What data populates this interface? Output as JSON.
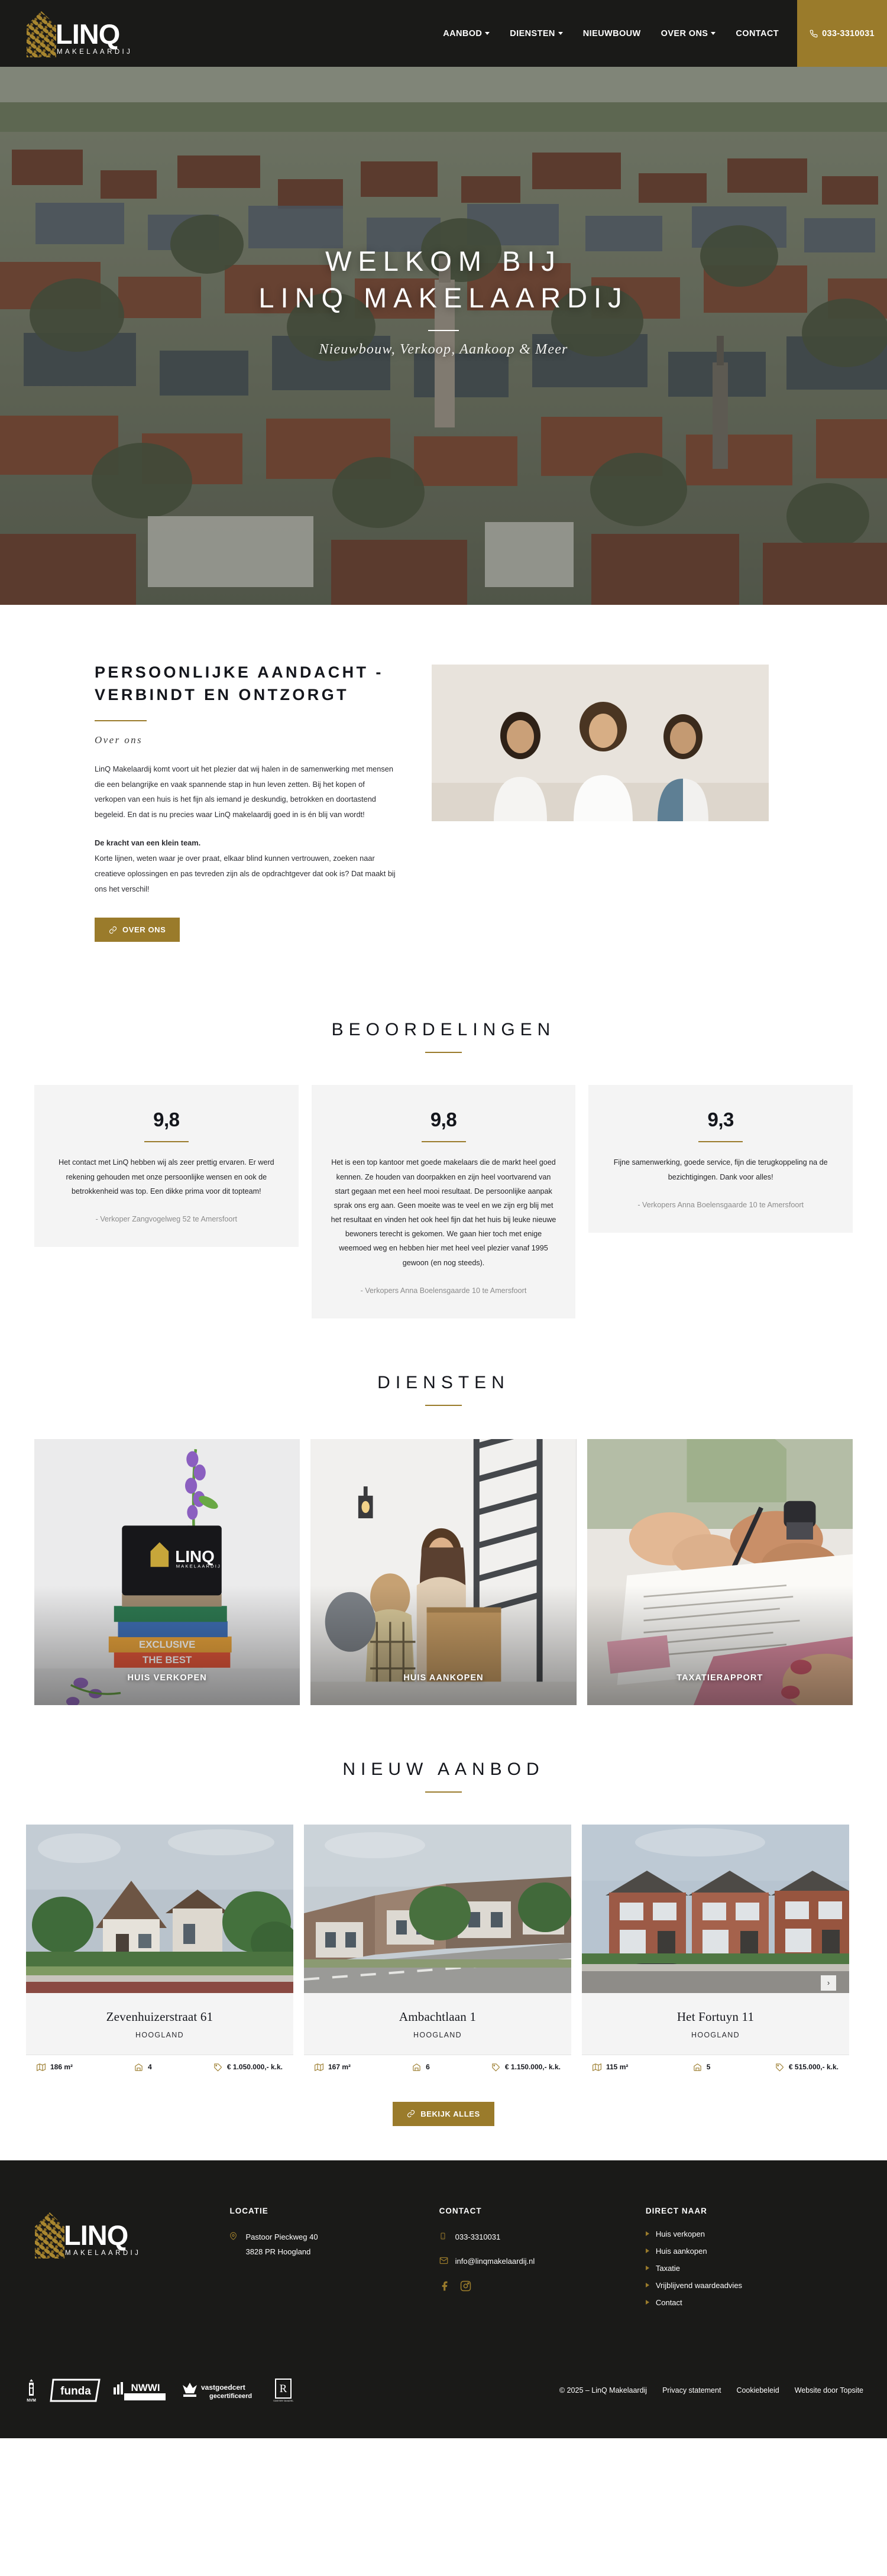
{
  "header": {
    "logo_name": "LINQ",
    "logo_sub": "MAKELAARDIJ",
    "nav": [
      {
        "label": "AANBOD",
        "has_caret": true
      },
      {
        "label": "DIENSTEN",
        "has_caret": true
      },
      {
        "label": "NIEUWBOUW",
        "has_caret": false
      },
      {
        "label": "OVER ONS",
        "has_caret": true
      },
      {
        "label": "CONTACT",
        "has_caret": false
      }
    ],
    "phone": "033-3310031"
  },
  "hero": {
    "title_line1": "WELKOM BIJ",
    "title_line2": "LINQ MAKELAARDIJ",
    "subtitle": "Nieuwbouw, Verkoop, Aankoop & Meer"
  },
  "about": {
    "heading": "PERSOONLIJKE AANDACHT - VERBINDT EN ONTZORGT",
    "eyebrow": "Over ons",
    "paragraph1": "LinQ Makelaardij komt voort uit het plezier dat wij halen in de samenwerking met mensen die een belangrijke en vaak spannende stap in hun leven zetten. Bij het kopen of verkopen van een huis is het fijn als iemand je deskundig, betrokken en doortastend begeleid. En dat is nu precies waar LinQ makelaardij goed in is én blij van wordt!",
    "bold_line": "De kracht van een klein team.",
    "paragraph2": "Korte lijnen, weten waar je over praat, elkaar blind kunnen vertrouwen, zoeken naar creatieve oplossingen en pas tevreden zijn als de opdrachtgever dat ook is? Dat maakt bij ons het verschil!",
    "button": "OVER ONS"
  },
  "reviews": {
    "title": "BEOORDELINGEN",
    "cards": [
      {
        "score": "9,8",
        "text": "Het contact met LinQ hebben wij als zeer prettig ervaren. Er werd rekening gehouden met onze persoonlijke wensen en ook de betrokkenheid was top. Een dikke prima voor dit topteam!",
        "author": "- Verkoper Zangvogelweg 52 te Amersfoort"
      },
      {
        "score": "9,8",
        "text": "Het is een top kantoor met goede makelaars die de markt heel goed kennen. Ze houden van doorpakken en zijn heel voortvarend van start gegaan met een heel mooi resultaat. De persoonlijke aanpak sprak ons erg aan. Geen moeite was te veel en we zijn erg blij met het resultaat en vinden het ook heel fijn dat het huis bij leuke nieuwe bewoners terecht is gekomen. We gaan hier toch met enige weemoed weg en hebben hier met heel veel plezier vanaf 1995 gewoon (en nog steeds).",
        "author": "- Verkopers Anna Boelensgaarde 10 te Amersfoort"
      },
      {
        "score": "9,3",
        "text": "Fijne samenwerking, goede service, fijn die terugkoppeling na de bezichtigingen. Dank voor alles!",
        "author": "- Verkopers Anna Boelensgaarde 10 te Amersfoort"
      }
    ]
  },
  "diensten": {
    "title": "DIENSTEN",
    "cards": [
      {
        "label": "HUIS VERKOPEN"
      },
      {
        "label": "HUIS AANKOPEN"
      },
      {
        "label": "TAXATIERAPPORT"
      }
    ]
  },
  "aanbod": {
    "title": "NIEUW AANBOD",
    "button": "BEKIJK ALLES",
    "properties": [
      {
        "title": "Zevenhuizerstraat 61",
        "city": "HOOGLAND",
        "area": "186 m²",
        "rooms": "4",
        "price": "€ 1.050.000,- k.k."
      },
      {
        "title": "Ambachtlaan 1",
        "city": "HOOGLAND",
        "area": "167 m²",
        "rooms": "6",
        "price": "€ 1.150.000,- k.k."
      },
      {
        "title": "Het Fortuyn 11",
        "city": "HOOGLAND",
        "area": "115 m²",
        "rooms": "5",
        "price": "€ 515.000,- k.k."
      }
    ]
  },
  "footer": {
    "locatie": {
      "heading": "LOCATIE",
      "address_line1": "Pastoor Pieckweg 40",
      "address_line2": "3828 PR Hoogland"
    },
    "contact": {
      "heading": "CONTACT",
      "phone": "033-3310031",
      "email": "info@linqmakelaardij.nl"
    },
    "direct_naar": {
      "heading": "DIRECT NAAR",
      "links": [
        "Huis verkopen",
        "Huis aankopen",
        "Taxatie",
        "Vrijblijvend waardeadvies",
        "Contact"
      ]
    },
    "certifications": [
      "NVM",
      "funda",
      "NWWI",
      "vastgoedcert gecertificeerd",
      "Register Taxateur"
    ],
    "copyright": "© 2025 – LinQ Makelaardij",
    "legal_links": [
      "Privacy statement",
      "Cookiebeleid",
      "Website door Topsite"
    ]
  },
  "colors": {
    "gold": "#9a7b2b",
    "dark": "#1a1a18",
    "light_panel": "#f4f4f4"
  }
}
